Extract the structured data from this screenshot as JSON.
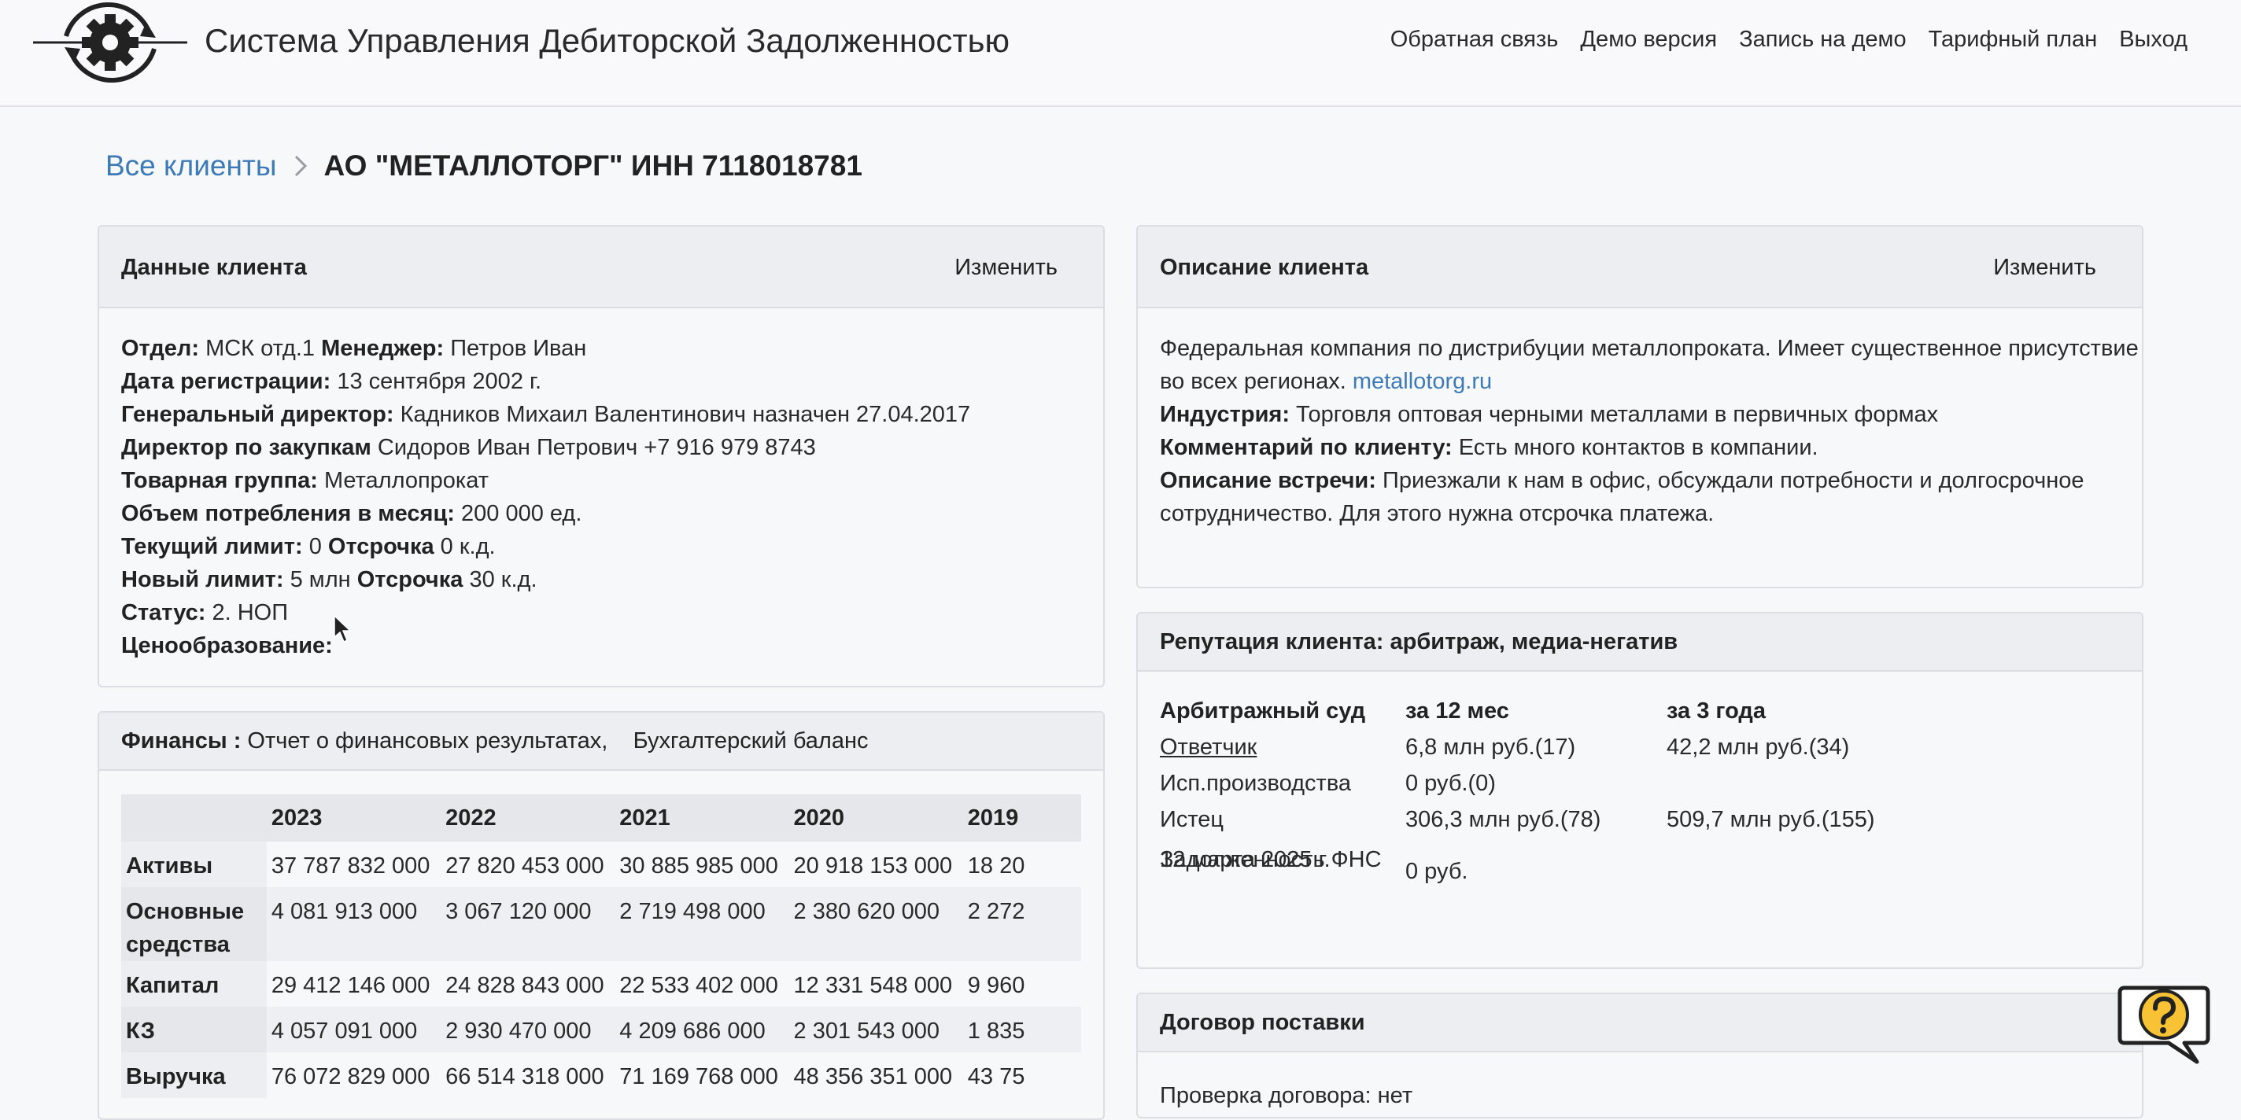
{
  "header": {
    "app_title": "Система Управления Дебиторской Задолженностью",
    "nav": [
      "Обратная связь",
      "Демо версия",
      "Запись на демо",
      "Тарифный план",
      "Выход"
    ]
  },
  "breadcrumb": {
    "link": "Все клиенты",
    "current": "АО \"МЕТАЛЛОТОРГ\" ИНН 7118018781"
  },
  "client_data": {
    "title": "Данные клиента",
    "action": "Изменить",
    "department_label": "Отдел:",
    "department": "МСК отд.1",
    "manager_label": "Менеджер:",
    "manager": "Петров Иван",
    "reg_date_label": "Дата регистрации:",
    "reg_date": "13 сентября 2002 г.",
    "ceo_label": "Генеральный директор:",
    "ceo": "Кадников Михаил Валентинович назначен 27.04.2017",
    "purchasing_label": "Директор по закупкам",
    "purchasing": "Сидоров Иван Петрович +7 916 979 8743",
    "group_label": "Товарная группа:",
    "group": "Металлопрокат",
    "volume_label": "Объем потребления в месяц:",
    "volume": "200 000 ед.",
    "cur_limit_label": "Текущий лимит:",
    "cur_limit": "0",
    "cur_delay_label": "Отсрочка",
    "cur_delay": "0 к.д.",
    "new_limit_label": "Новый лимит:",
    "new_limit": "5 млн",
    "new_delay_label": "Отсрочка",
    "new_delay": "30 к.д.",
    "status_label": "Статус:",
    "status": "2. НОП",
    "pricing_label": "Ценообразование:"
  },
  "client_desc": {
    "title": "Описание клиента",
    "action": "Изменить",
    "line1": "Федеральная компания по дистрибуции металлопроката. Имеет существенное присутствие",
    "line2": "во всех регионах.",
    "site": "metallotorg.ru",
    "industry_label": "Индустрия:",
    "industry": "Торговля оптовая черными металлами в первичных формах",
    "comment_label": "Комментарий по клиенту:",
    "comment": "Есть много контактов в компании.",
    "meeting_label": "Описание встречи:",
    "meeting1": "Приезжали к нам в офис, обсуждали потребности и долгосрочное",
    "meeting2": "сотрудничество. Для этого нужна отсрочка платежа."
  },
  "reputation": {
    "title": "Репутация клиента: арбитраж, медиа-негатив",
    "h1": "Арбитражный суд",
    "h2": "за 12 мес",
    "h3": "за 3 года",
    "defendant": "Ответчик",
    "defendant_12": "6,8 млн руб.(17)",
    "defendant_3y": "42,2 млн руб.(34)",
    "enforcement": "Исп.производства",
    "enforcement_12": "0 руб.(0)",
    "plaintiff": "Истец",
    "plaintiff_12": "306,3 млн руб.(78)",
    "plaintiff_3y": "509,7 млн руб.(155)",
    "tax_debt_1": "Задолженность ФНС",
    "tax_debt_2": "12 марта 2025 г.",
    "tax_debt_val": "0 руб."
  },
  "finance": {
    "title": "Финансы :",
    "link1": "Отчет о финансовых результатах,",
    "link2": "Бухгалтерский баланс",
    "years": [
      "2023",
      "2022",
      "2021",
      "2020",
      "2019"
    ],
    "rows": [
      {
        "label": "Активы",
        "vals": [
          "37 787 832 000",
          "27 820 453 000",
          "30 885 985 000",
          "20 918 153 000",
          "18 20"
        ]
      },
      {
        "label": "Основные средства",
        "vals": [
          "4 081 913 000",
          "3 067 120 000",
          "2 719 498 000",
          "2 380 620 000",
          "2 272"
        ]
      },
      {
        "label": "Капитал",
        "vals": [
          "29 412 146 000",
          "24 828 843 000",
          "22 533 402 000",
          "12 331 548 000",
          "9 960"
        ]
      },
      {
        "label": "КЗ",
        "vals": [
          "4 057 091 000",
          "2 930 470 000",
          "4 209 686 000",
          "2 301 543 000",
          "1 835"
        ]
      },
      {
        "label": "Выручка",
        "vals": [
          "76 072 829 000",
          "66 514 318 000",
          "71 169 768 000",
          "48 356 351 000",
          "43 75"
        ]
      }
    ]
  },
  "contract": {
    "title": "Договор поставки",
    "check": "Проверка договора: нет"
  },
  "colors": {
    "accent": "#3d7ab8",
    "help_yellow": "#f7c233"
  },
  "icons": {
    "logo": "gear-cycle-logo-icon",
    "breadcrumb_sep": "chevron-right-icon",
    "help": "help-chat-icon"
  }
}
